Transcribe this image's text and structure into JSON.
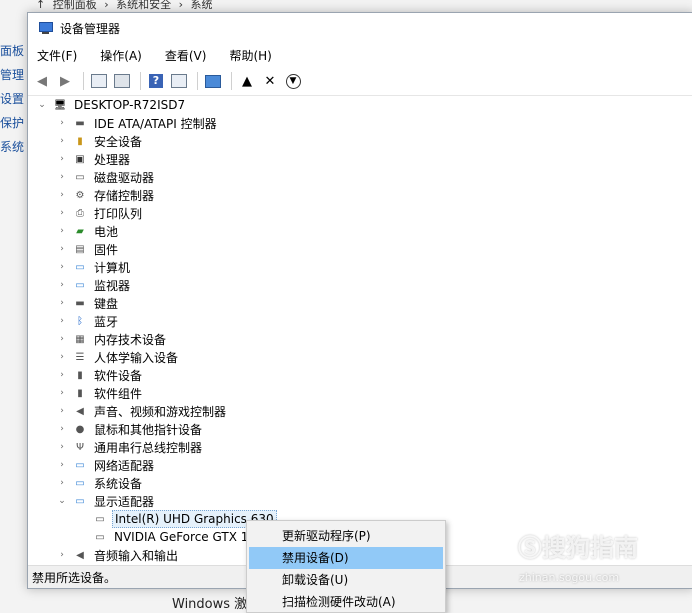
{
  "background": {
    "breadcrumb": [
      "控制面板",
      "系统和安全",
      "系统"
    ],
    "side_links": [
      "面板",
      "管理",
      "设置",
      "保护",
      "系统"
    ],
    "taskbar_text": "Windows 激"
  },
  "window": {
    "title": "设备管理器",
    "menu": [
      "文件(F)",
      "操作(A)",
      "查看(V)",
      "帮助(H)"
    ],
    "toolbar_icons": [
      "back-arrow-icon",
      "forward-arrow-icon",
      "properties-icon",
      "driver-icon",
      "help-icon",
      "view-icon",
      "monitor-icon",
      "update-driver-icon",
      "uninstall-icon",
      "scan-icon"
    ],
    "root": "DESKTOP-R72ISD7",
    "categories": [
      {
        "label": "IDE ATA/ATAPI 控制器",
        "icon": "ide-controller-icon"
      },
      {
        "label": "安全设备",
        "icon": "security-device-icon"
      },
      {
        "label": "处理器",
        "icon": "processor-icon"
      },
      {
        "label": "磁盘驱动器",
        "icon": "disk-drive-icon"
      },
      {
        "label": "存储控制器",
        "icon": "storage-controller-icon"
      },
      {
        "label": "打印队列",
        "icon": "printer-icon"
      },
      {
        "label": "电池",
        "icon": "battery-icon"
      },
      {
        "label": "固件",
        "icon": "firmware-icon"
      },
      {
        "label": "计算机",
        "icon": "computer-icon"
      },
      {
        "label": "监视器",
        "icon": "monitor-icon"
      },
      {
        "label": "键盘",
        "icon": "keyboard-icon"
      },
      {
        "label": "蓝牙",
        "icon": "bluetooth-icon"
      },
      {
        "label": "内存技术设备",
        "icon": "memory-icon"
      },
      {
        "label": "人体学输入设备",
        "icon": "hid-icon"
      },
      {
        "label": "软件设备",
        "icon": "software-device-icon"
      },
      {
        "label": "软件组件",
        "icon": "software-component-icon"
      },
      {
        "label": "声音、视频和游戏控制器",
        "icon": "speaker-icon"
      },
      {
        "label": "鼠标和其他指针设备",
        "icon": "mouse-icon"
      },
      {
        "label": "通用串行总线控制器",
        "icon": "usb-icon"
      },
      {
        "label": "网络适配器",
        "icon": "network-icon"
      },
      {
        "label": "系统设备",
        "icon": "system-device-icon"
      },
      {
        "label": "显示适配器",
        "icon": "display-adapter-icon",
        "expanded": true
      }
    ],
    "display_children": [
      "Intel(R) UHD Graphics 630",
      "NVIDIA GeForce GTX 10"
    ],
    "last_category": "音频输入和输出",
    "status": "禁用所选设备。"
  },
  "context_menu": {
    "items": [
      "更新驱动程序(P)",
      "禁用设备(D)",
      "卸载设备(U)",
      "扫描检测硬件改动(A)"
    ],
    "highlighted_index": 1
  },
  "watermark": {
    "text": "搜狗指南",
    "url": "zhinan.sogou.com"
  },
  "colors": {
    "highlight": "#91c9f7",
    "selection": "#e5f1fb"
  }
}
